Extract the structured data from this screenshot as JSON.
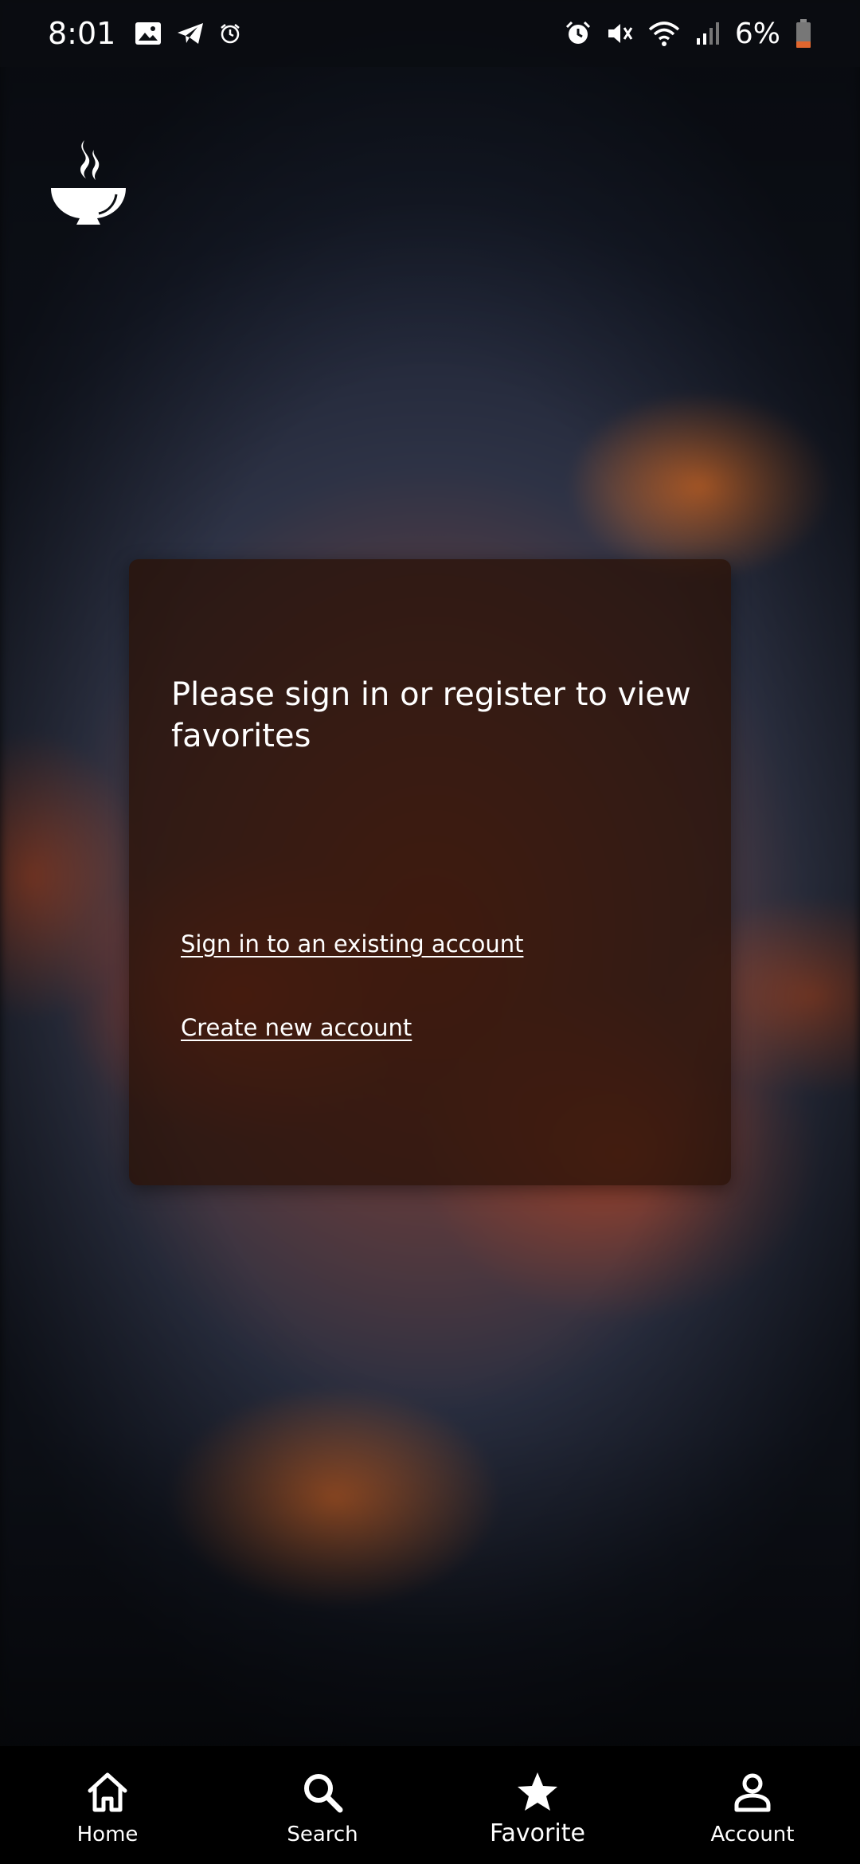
{
  "status_bar": {
    "time": "8:01",
    "battery_percent": "6%",
    "icons": [
      "image-icon",
      "telegram-icon",
      "alarm-icon",
      "alarm-clock-icon",
      "mute-icon",
      "wifi-icon",
      "signal-icon",
      "battery-low-icon"
    ],
    "battery_color": "#e0662e"
  },
  "app": {
    "logo_icon": "steaming-bowl-icon"
  },
  "card": {
    "message": "Please sign in or register to view favorites",
    "sign_in_link": "Sign in to an existing account",
    "create_account_link": "Create new account"
  },
  "bottom_nav": {
    "items": [
      {
        "label": "Home",
        "icon": "home-icon",
        "active": false
      },
      {
        "label": "Search",
        "icon": "search-icon",
        "active": false
      },
      {
        "label": "Favorite",
        "icon": "star-icon",
        "active": true
      },
      {
        "label": "Account",
        "icon": "account-icon",
        "active": false
      }
    ]
  }
}
